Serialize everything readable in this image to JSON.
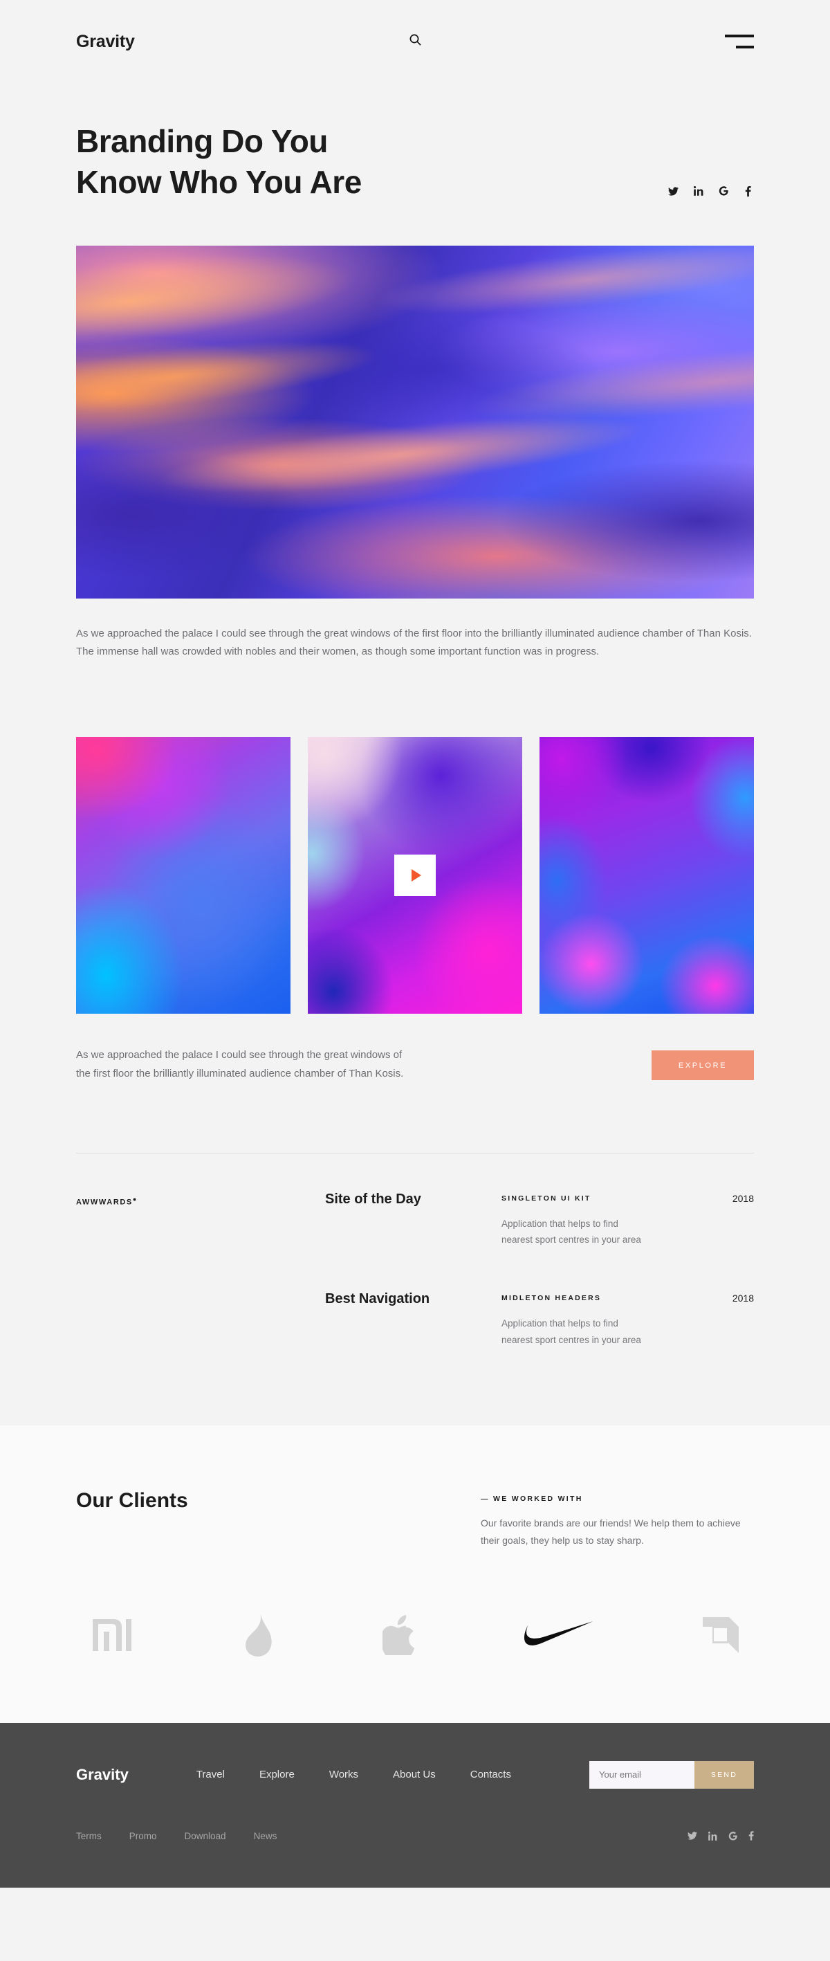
{
  "header": {
    "logo": "Gravity",
    "search_icon": "search-icon",
    "menu_icon": "hamburger-menu-icon"
  },
  "hero": {
    "title_line1": "Branding Do You",
    "title_line2": "Know Who You Are",
    "social": [
      {
        "name": "twitter-icon",
        "glyph": "twitter"
      },
      {
        "name": "linkedin-icon",
        "glyph": "in"
      },
      {
        "name": "google-icon",
        "glyph": "G"
      },
      {
        "name": "facebook-icon",
        "glyph": "f"
      }
    ],
    "caption": "As we approached the palace I could see through the great windows of the first floor into the brilliantly illuminated audience chamber of Than Kosis. The immense hall was crowded with nobles and their women, as though some important function was in progress."
  },
  "gallery": {
    "items": [
      {
        "name": "gallery-image-1"
      },
      {
        "name": "gallery-image-2-video"
      },
      {
        "name": "gallery-image-3"
      }
    ],
    "play_icon": "play-icon",
    "caption": "As we approached the palace I could see through the great windows of the first floor the brilliantly illuminated audience chamber of Than Kosis.",
    "explore_label": "EXPLORE",
    "explore_color": "#f09377"
  },
  "awards": {
    "brand": "AWWWARDS",
    "rows": [
      {
        "title": "Site of the Day",
        "kit": "SINGLETON UI KIT",
        "description": "Application that helps to find nearest sport centres in your area",
        "year": "2018"
      },
      {
        "title": "Best Navigation",
        "kit": "MIDLETON HEADERS",
        "description": "Application that helps to find nearest sport centres in your area",
        "year": "2018"
      }
    ]
  },
  "clients": {
    "title": "Our Clients",
    "kicker": "—  WE WORKED WITH",
    "description": "Our favorite brands are our friends! We help them to achieve their goals, they help us to stay sharp.",
    "logos": [
      {
        "name": "xiaomi-logo",
        "label": "Xiaomi"
      },
      {
        "name": "tinder-logo",
        "label": "Tinder"
      },
      {
        "name": "apple-logo",
        "label": "Apple"
      },
      {
        "name": "nike-logo",
        "label": "Nike"
      },
      {
        "name": "amd-logo",
        "label": "AMD"
      }
    ]
  },
  "footer": {
    "logo": "Gravity",
    "nav": [
      "Travel",
      "Explore",
      "Works",
      "About Us",
      "Contacts"
    ],
    "email_placeholder": "Your email",
    "send_label": "SEND",
    "send_color": "#cbb189",
    "links": [
      "Terms",
      "Promo",
      "Download",
      "News"
    ],
    "social": [
      {
        "name": "twitter-icon",
        "glyph": "twitter"
      },
      {
        "name": "linkedin-icon",
        "glyph": "in"
      },
      {
        "name": "google-icon",
        "glyph": "G"
      },
      {
        "name": "facebook-icon",
        "glyph": "f"
      }
    ]
  }
}
